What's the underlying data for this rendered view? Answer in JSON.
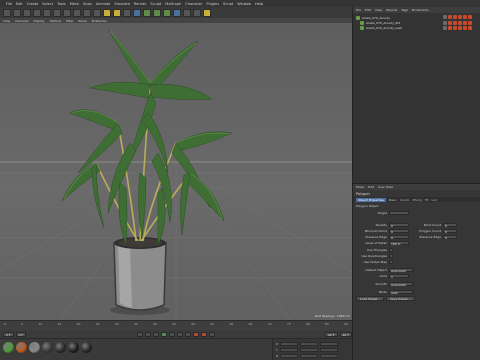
{
  "menubar": {
    "items": [
      "File",
      "Edit",
      "Create",
      "Select",
      "Tools",
      "Mesh",
      "Snap",
      "Animate",
      "Simulate",
      "Render",
      "Sculpt",
      "MoGraph",
      "Character",
      "Plugins",
      "Script",
      "Window",
      "Help"
    ]
  },
  "viewport_menu": {
    "items": [
      "View",
      "Cameras",
      "Display",
      "Options",
      "Filter",
      "Panel",
      "ProRender"
    ]
  },
  "viewport": {
    "status_text": "Grid Spacing : 1000 cm"
  },
  "object_manager": {
    "tabs": [
      "File",
      "Edit",
      "View",
      "Objects",
      "Tags",
      "Bookmarks"
    ],
    "rows": [
      "Areka_070_Aroudy",
      "Areka_070_Aroudy_Pot",
      "Areka_070_Aroudy_Leaf"
    ]
  },
  "attribute_manager": {
    "tabs": [
      "Mode",
      "Edit",
      "User Data"
    ],
    "title": "Polygon",
    "subtabs": [
      "Object Properties",
      "Basic",
      "Coord.",
      "Phong",
      "Fit",
      "Lod"
    ],
    "section": "Polygon Object",
    "props_left": [
      {
        "label": "Target",
        "value": ""
      },
      {
        "label": "Density",
        "value": "0"
      },
      {
        "label": "Minimum Point",
        "value": "0"
      },
      {
        "label": "Preserve Edge",
        "value": "0"
      },
      {
        "label": "Level of Detail",
        "value": "100 %"
      }
    ],
    "props_right": [
      {
        "label": "Point Count",
        "value": "0"
      },
      {
        "label": "Polygon Count",
        "value": "0"
      },
      {
        "label": "Preserve Edge",
        "value": "0"
      }
    ],
    "checks": [
      "Use Triangles",
      "Use Quadrangles",
      "Use Vertex Map"
    ],
    "buttons": [
      "Load Preset...",
      "Save Preset..."
    ],
    "extra_fields": [
      {
        "label": "Default Object",
        "value": "Automatic"
      },
      {
        "label": "Limit",
        "value": "1"
      },
      {
        "label": "Smooth",
        "value": "Automatic"
      },
      {
        "label": "Mode",
        "value": "Auto"
      }
    ]
  },
  "timeline": {
    "ticks": [
      "0",
      "5",
      "10",
      "15",
      "20",
      "25",
      "30",
      "35",
      "40",
      "45",
      "50",
      "55",
      "60",
      "65",
      "70",
      "75",
      "80",
      "85",
      "90"
    ],
    "start": "0 F",
    "current": "0 F",
    "end": "90 F",
    "max": "90 F"
  },
  "materials": {
    "swatches": [
      "#4c9c3a",
      "#c05a1c",
      "#8a8a8a",
      "#3a3a3a",
      "#2a2a2a",
      "#1e1e1e",
      "#262626"
    ]
  },
  "coordinates": {
    "rows": [
      "X",
      "Y",
      "Z"
    ],
    "apply_label": "Apply"
  }
}
